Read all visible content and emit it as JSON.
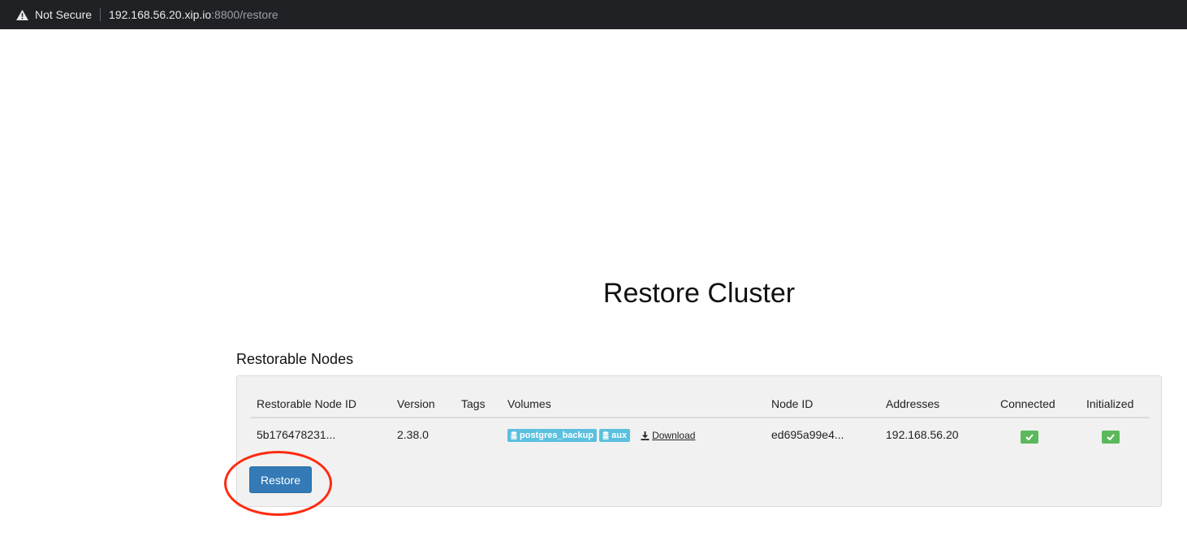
{
  "browser": {
    "security_label": "Not Secure",
    "url_host": "192.168.56.20.xip.io",
    "url_path": ":8800/restore"
  },
  "page": {
    "title": "Restore Cluster",
    "section_title": "Restorable Nodes"
  },
  "table": {
    "headers": {
      "restorable_node_id": "Restorable Node ID",
      "version": "Version",
      "tags": "Tags",
      "volumes": "Volumes",
      "node_id": "Node ID",
      "addresses": "Addresses",
      "connected": "Connected",
      "initialized": "Initialized"
    },
    "rows": [
      {
        "restorable_node_id": "5b176478231...",
        "version": "2.38.0",
        "tags": "",
        "volumes": [
          "postgres_backup",
          "aux"
        ],
        "download_label": "Download",
        "node_id": "ed695a99e4...",
        "addresses": "192.168.56.20",
        "connected": true,
        "initialized": true
      }
    ]
  },
  "actions": {
    "restore_label": "Restore"
  },
  "colors": {
    "primary": "#337ab7",
    "info_badge": "#5bc0de",
    "success": "#5cb85c",
    "highlight": "#ff2a10"
  },
  "icons": {
    "security": "warning-triangle-icon",
    "volume": "database-icon",
    "download": "download-icon",
    "status": "check-icon"
  }
}
